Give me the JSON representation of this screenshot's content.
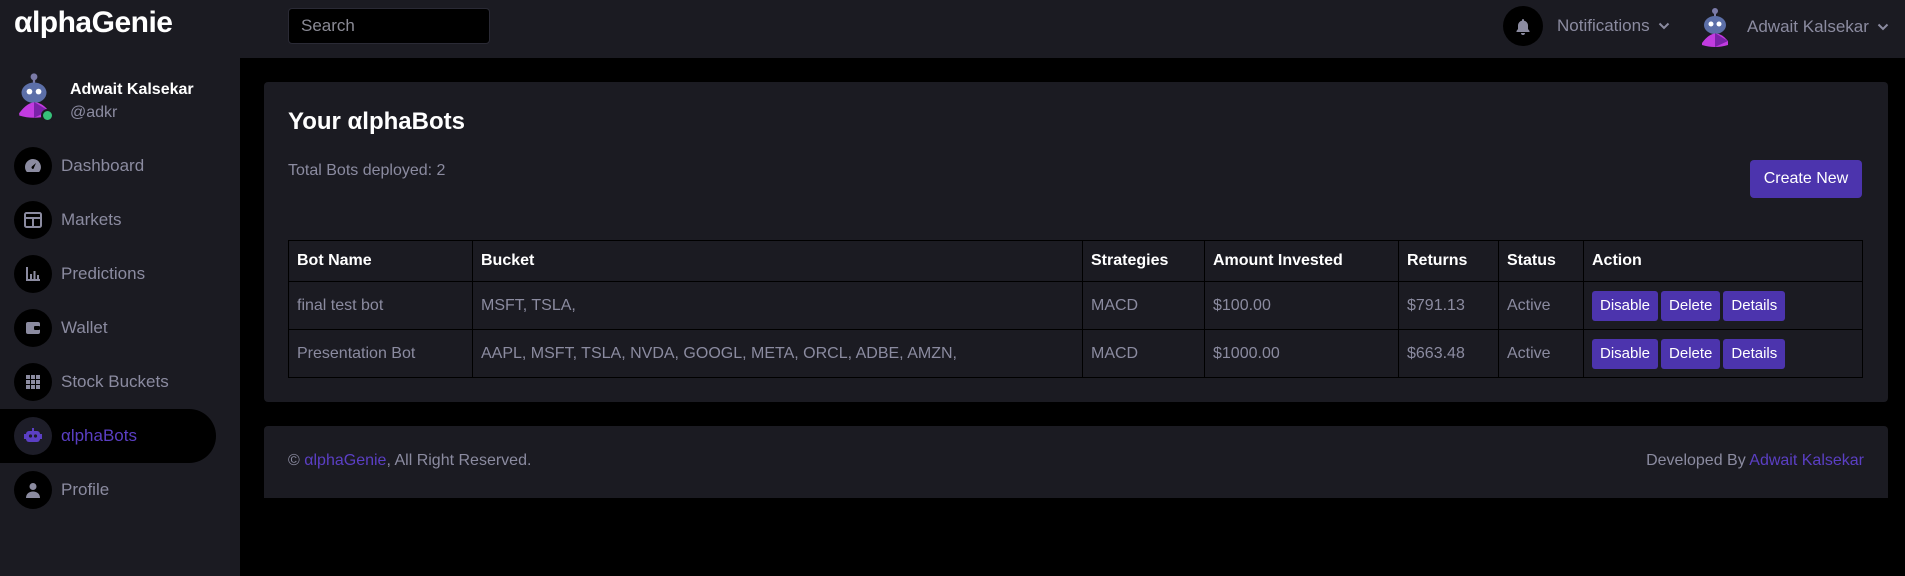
{
  "app": {
    "logo": "αlphaGenie"
  },
  "header": {
    "search_placeholder": "Search",
    "notifications_label": "Notifications",
    "user_label": "Adwait Kalsekar"
  },
  "sidebar": {
    "user_name": "Adwait Kalsekar",
    "user_handle": "@adkr",
    "items": [
      {
        "label": "Dashboard",
        "icon": "dashboard-icon",
        "active": false
      },
      {
        "label": "Markets",
        "icon": "table-icon",
        "active": false
      },
      {
        "label": "Predictions",
        "icon": "chart-icon",
        "active": false
      },
      {
        "label": "Wallet",
        "icon": "wallet-icon",
        "active": false
      },
      {
        "label": "Stock Buckets",
        "icon": "grid-icon",
        "active": false
      },
      {
        "label": "αlphaBots",
        "icon": "robot-icon",
        "active": true
      },
      {
        "label": "Profile",
        "icon": "user-icon",
        "active": false
      }
    ]
  },
  "main": {
    "title": "Your αlphaBots",
    "subtitle": "Total Bots deployed: 2",
    "create_label": "Create New",
    "table": {
      "headers": [
        "Bot Name",
        "Bucket",
        "Strategies",
        "Amount Invested",
        "Returns",
        "Status",
        "Action"
      ],
      "rows": [
        {
          "name": "final test bot",
          "bucket": "MSFT, TSLA,",
          "strategy": "MACD",
          "amount": "$100.00",
          "returns": "$791.13",
          "status": "Active"
        },
        {
          "name": "Presentation Bot",
          "bucket": "AAPL, MSFT, TSLA, NVDA, GOOGL, META, ORCL, ADBE, AMZN,",
          "strategy": "MACD",
          "amount": "$1000.00",
          "returns": "$663.48",
          "status": "Active"
        }
      ],
      "actions": {
        "disable": "Disable",
        "delete": "Delete",
        "details": "Details"
      }
    }
  },
  "footer": {
    "copyright_symbol": "©",
    "brand": "αlphaGenie",
    "rights": ", All Right Reserved.",
    "developed_by": "Developed By ",
    "developer": "Adwait Kalsekar"
  },
  "colors": {
    "accent": "#4c34ad",
    "accent_text": "#5b3fc4",
    "panel": "#1b1b22",
    "background": "#000000",
    "online": "#37c27a"
  }
}
